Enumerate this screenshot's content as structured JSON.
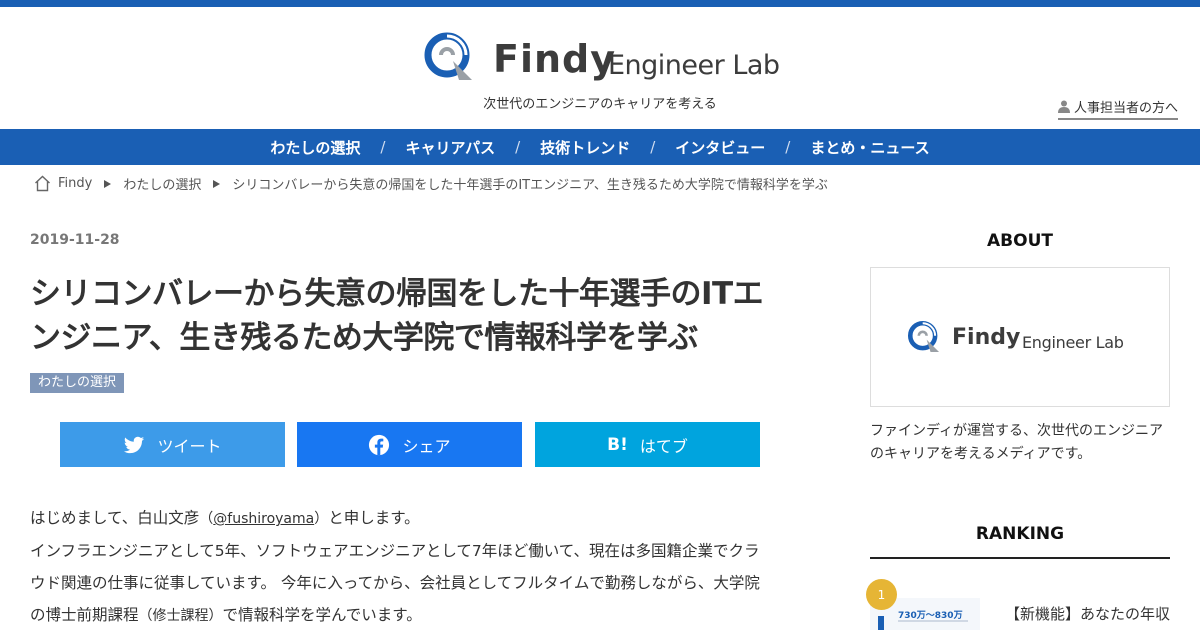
{
  "site": {
    "logo_findy": "Findy",
    "logo_lab": "Engineer Lab",
    "tagline": "次世代のエンジニアのキャリアを考える",
    "hr_link": "人事担当者の方へ",
    "brand_color": "#1a5fb4"
  },
  "nav": {
    "items": [
      "わたしの選択",
      "キャリアパス",
      "技術トレンド",
      "インタビュー",
      "まとめ・ニュース"
    ],
    "separator": "/"
  },
  "breadcrumb": {
    "items": [
      "Findy",
      "わたしの選択",
      "シリコンバレーから失意の帰国をした十年選手のITエンジニア、生き残るため大学院で情報科学を学ぶ"
    ]
  },
  "article": {
    "date": "2019-11-28",
    "title": "シリコンバレーから失意の帰国をした十年選手のITエンジニア、生き残るため大学院で情報科学を学ぶ",
    "category": "わたしの選択",
    "share": {
      "tweet": "ツイート",
      "facebook": "シェア",
      "hatena_icon": "B!",
      "hatena": "はてブ"
    },
    "body": {
      "p1_before": "はじめまして、白山文彦",
      "p1_paren_open": "（",
      "p1_handle": "@fushiroyama",
      "p1_paren_close": "）",
      "p1_after": "と申します。",
      "line2": "インフラエンジニアとして5年、ソフトウェアエンジニアとして7年ほど働いて、現在は多国籍企業でクラ",
      "line3": "ウド関連の仕事に従事しています。 今年に入ってから、会社員としてフルタイムで勤務しながら、大学院",
      "line4_before": "の博士前期課程",
      "line4_paren": "（修士課程）",
      "line4_after": "で情報科学を学んでいます。"
    }
  },
  "sidebar": {
    "about_heading": "ABOUT",
    "about_logo_findy": "Findy",
    "about_logo_lab": "Engineer Lab",
    "about_desc": "ファインディが運営する、次世代のエンジニアのキャリアを考えるメディアです。",
    "ranking_heading": "RANKING",
    "ranking": [
      {
        "rank": "1",
        "title": "【新機能】あなたの年収",
        "thumb_caption": "730万〜830万"
      }
    ]
  },
  "icons": {
    "logo": "findy-q-logo-icon",
    "user": "person-icon",
    "home": "home-icon",
    "twitter": "twitter-bird-icon",
    "facebook": "facebook-icon"
  }
}
